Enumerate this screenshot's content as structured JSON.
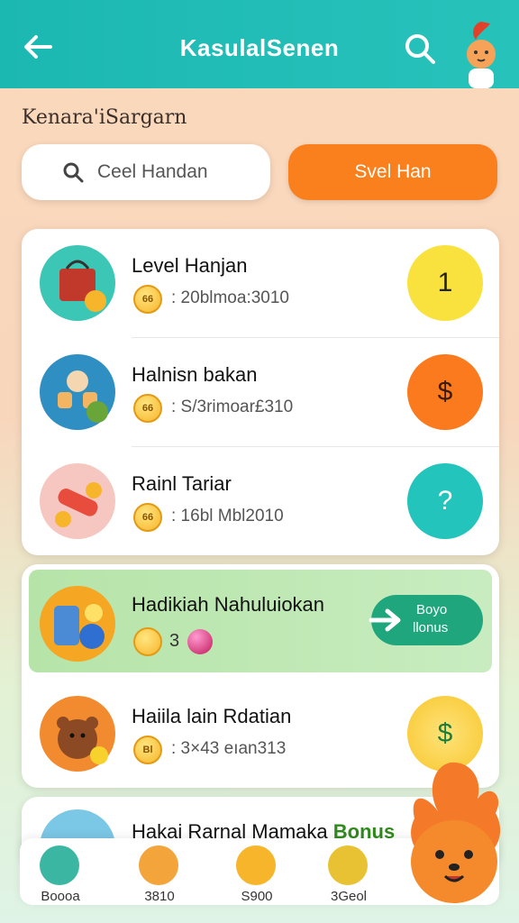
{
  "header": {
    "title": "KasulalSenen"
  },
  "subtitle": "Kenara'iSargarn",
  "search": {
    "placeholder": "Ceel Handan",
    "button_label": "Svel Han"
  },
  "rows": [
    {
      "name": "Level Hanjan",
      "coin_label": "66",
      "meta": ": 20blmoa:3010",
      "badge": "1",
      "badge_color": "#f9e23d",
      "badge_text_color": "#222"
    },
    {
      "name": "Halnisn bakan",
      "coin_label": "66",
      "meta": ": S/3rimoar£310",
      "badge": "$",
      "badge_color": "#fa7a1d",
      "badge_text_color": "#3a1a00"
    },
    {
      "name": "Rainl Tariar",
      "coin_label": "66",
      "meta": ": 16bl Mbl2010",
      "badge": "?",
      "badge_color": "#22c4bb",
      "badge_text_color": "#ffffff"
    },
    {
      "name": "Haiila lain Rdatian",
      "coin_label": "Bl",
      "meta": ": 3×43 eıan313",
      "badge": "$",
      "badge_color": "#fbd33c",
      "badge_text_color": "#1b7d3a"
    }
  ],
  "promo": {
    "name": "Hadikiah Nahuluiokan",
    "count": "3",
    "button_line1": "Boyo",
    "button_line2": "llonus"
  },
  "partial_row": {
    "name": "Hakai Rarnal Mamaka",
    "highlight": "Bonus"
  },
  "nav": [
    {
      "label": "Boooa",
      "icon": "wheel-icon",
      "color": "#3bb6a2"
    },
    {
      "label": "3810",
      "icon": "treasure-icon",
      "color": "#f3a43a"
    },
    {
      "label": "S900",
      "icon": "smile-coin-icon",
      "color": "#f7b52c"
    },
    {
      "label": "3Geol",
      "icon": "dollar-coin-icon",
      "color": "#e9c234"
    }
  ]
}
